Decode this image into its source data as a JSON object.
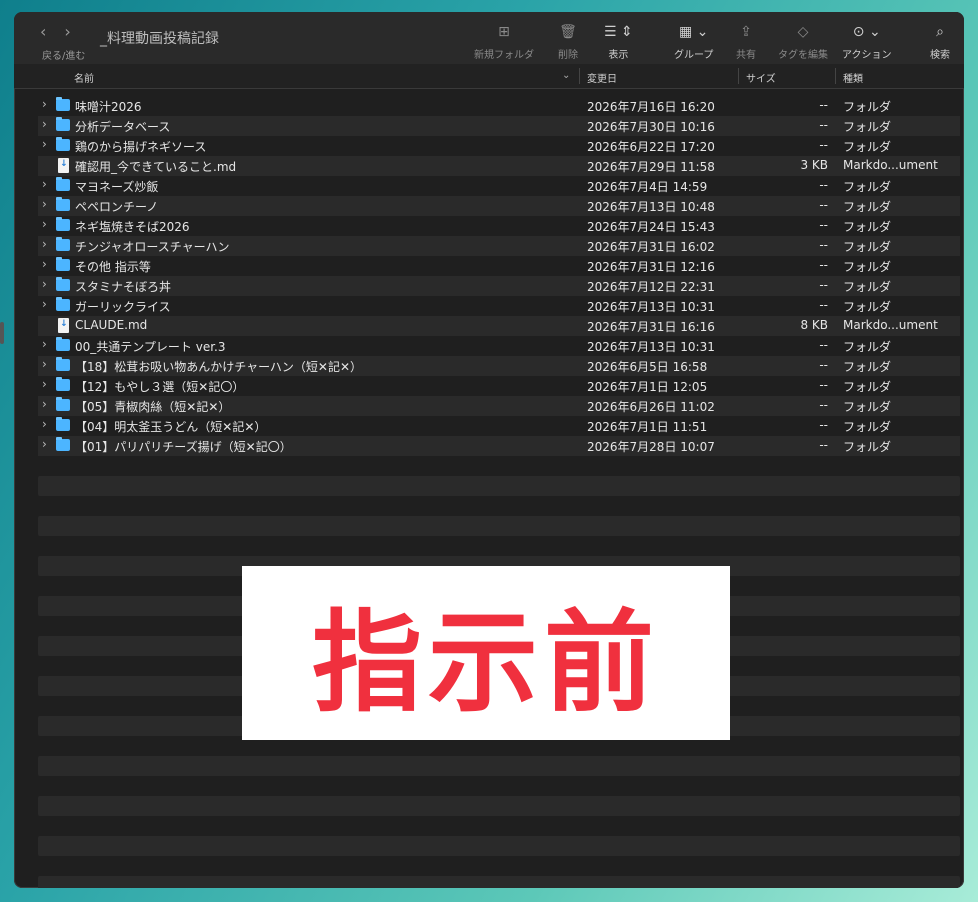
{
  "window": {
    "title": "_料理動画投稿記録"
  },
  "toolbar": {
    "nav_label": "戻る/進む",
    "back_icon": "chevron-left-icon",
    "forward_icon": "chevron-right-icon",
    "items": [
      {
        "label": "新規フォルダ",
        "icon": "folder-plus-icon"
      },
      {
        "label": "削除",
        "icon": "trash-icon"
      },
      {
        "label": "表示",
        "icon": "list-view-icon"
      },
      {
        "label": "グループ",
        "icon": "group-icon"
      },
      {
        "label": "共有",
        "icon": "share-icon"
      },
      {
        "label": "タグを編集",
        "icon": "tag-icon"
      },
      {
        "label": "アクション",
        "icon": "ellipsis-circle-icon"
      },
      {
        "label": "検索",
        "icon": "search-icon"
      }
    ]
  },
  "columns": {
    "name": "名前",
    "date": "変更日",
    "size": "サイズ",
    "kind": "種類"
  },
  "rows": [
    {
      "type": "folder",
      "name": "味噌汁2026",
      "date": "2026年7月16日 16:20",
      "size": "--",
      "kind": "フォルダ"
    },
    {
      "type": "folder",
      "name": "分析データベース",
      "date": "2026年7月30日 10:16",
      "size": "--",
      "kind": "フォルダ"
    },
    {
      "type": "folder",
      "name": "鶏のから揚げネギソース",
      "date": "2026年6月22日 17:20",
      "size": "--",
      "kind": "フォルダ"
    },
    {
      "type": "doc",
      "name": "確認用_今できていること.md",
      "date": "2026年7月29日 11:58",
      "size": "3 KB",
      "kind": "Markdo...ument"
    },
    {
      "type": "folder",
      "name": "マヨネーズ炒飯",
      "date": "2026年7月4日 14:59",
      "size": "--",
      "kind": "フォルダ"
    },
    {
      "type": "folder",
      "name": "ペペロンチーノ",
      "date": "2026年7月13日 10:48",
      "size": "--",
      "kind": "フォルダ"
    },
    {
      "type": "folder",
      "name": "ネギ塩焼きそば2026",
      "date": "2026年7月24日 15:43",
      "size": "--",
      "kind": "フォルダ"
    },
    {
      "type": "folder",
      "name": "チンジャオロースチャーハン",
      "date": "2026年7月31日 16:02",
      "size": "--",
      "kind": "フォルダ"
    },
    {
      "type": "folder",
      "name": "その他 指示等",
      "date": "2026年7月31日 12:16",
      "size": "--",
      "kind": "フォルダ"
    },
    {
      "type": "folder",
      "name": "スタミナそぼろ丼",
      "date": "2026年7月12日 22:31",
      "size": "--",
      "kind": "フォルダ"
    },
    {
      "type": "folder",
      "name": "ガーリックライス",
      "date": "2026年7月13日 10:31",
      "size": "--",
      "kind": "フォルダ"
    },
    {
      "type": "doc",
      "name": "CLAUDE.md",
      "date": "2026年7月31日 16:16",
      "size": "8 KB",
      "kind": "Markdo...ument"
    },
    {
      "type": "folder",
      "name": "00_共通テンプレート ver.3",
      "date": "2026年7月13日 10:31",
      "size": "--",
      "kind": "フォルダ"
    },
    {
      "type": "folder",
      "name": "【18】松茸お吸い物あんかけチャーハン（短✕記✕）",
      "date": "2026年6月5日 16:58",
      "size": "--",
      "kind": "フォルダ"
    },
    {
      "type": "folder",
      "name": "【12】もやし３選（短✕記〇）",
      "date": "2026年7月1日 12:05",
      "size": "--",
      "kind": "フォルダ"
    },
    {
      "type": "folder",
      "name": "【05】青椒肉絲（短✕記✕）",
      "date": "2026年6月26日 11:02",
      "size": "--",
      "kind": "フォルダ"
    },
    {
      "type": "folder",
      "name": "【04】明太釜玉うどん（短✕記✕）",
      "date": "2026年7月1日 11:51",
      "size": "--",
      "kind": "フォルダ"
    },
    {
      "type": "folder",
      "name": "【01】パリパリチーズ揚げ（短✕記〇）",
      "date": "2026年7月28日 10:07",
      "size": "--",
      "kind": "フォルダ"
    }
  ],
  "overlay": {
    "text": "指示前",
    "color": "#f0303e"
  }
}
